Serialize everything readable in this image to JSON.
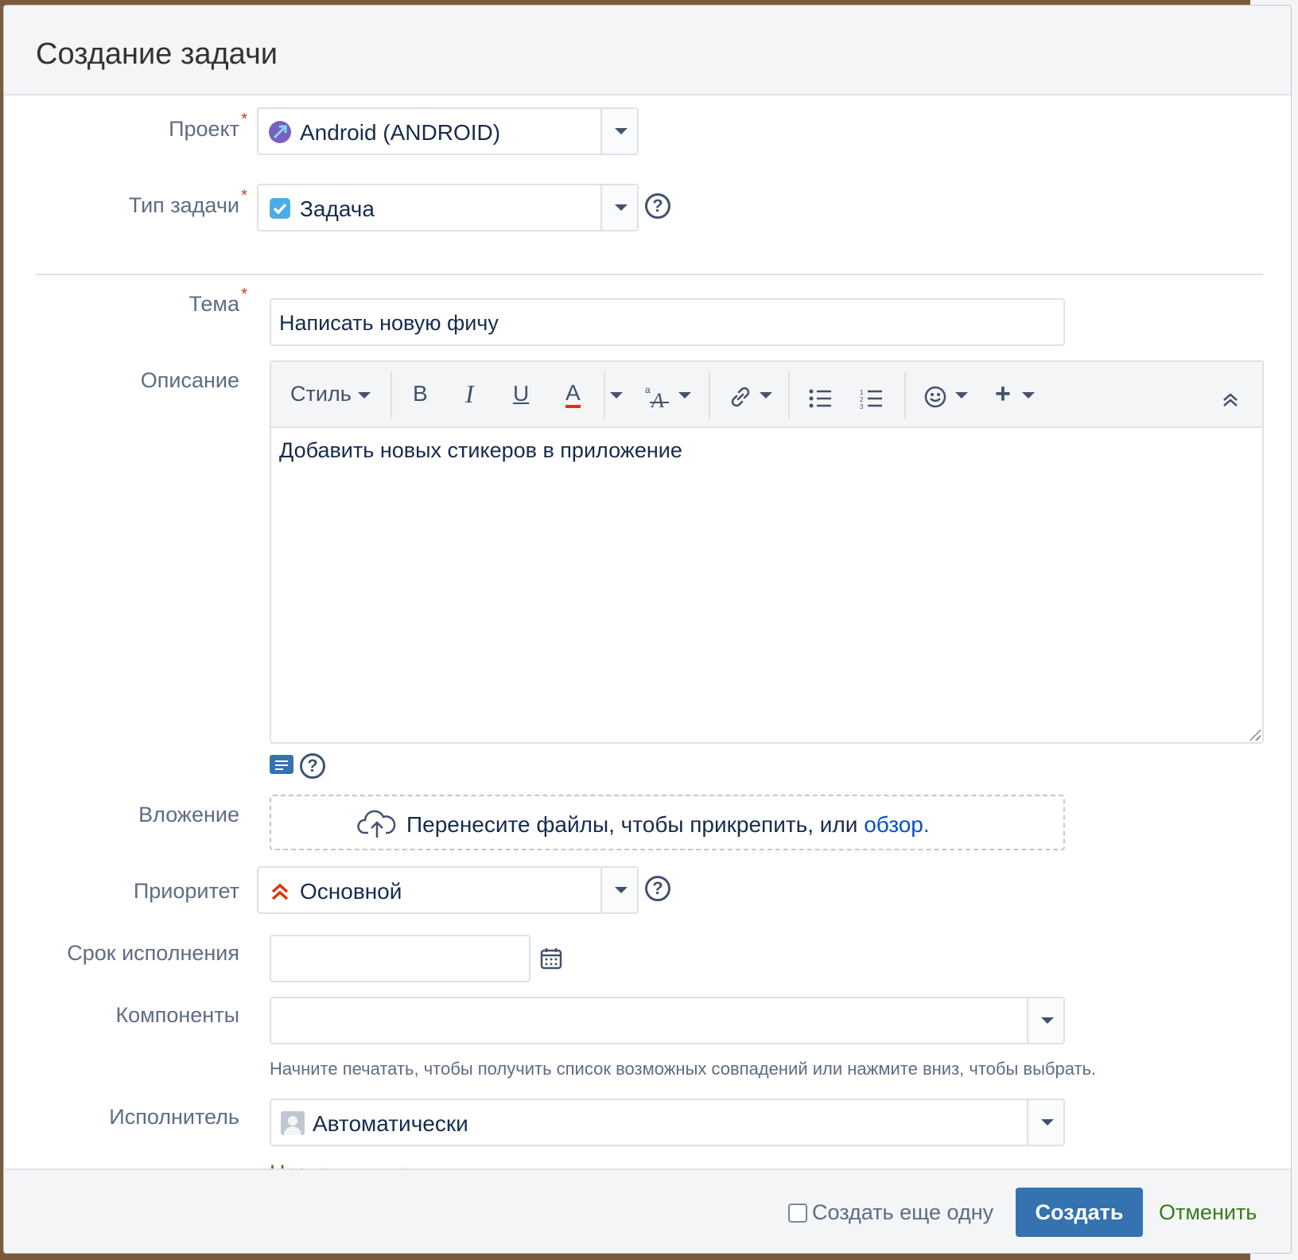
{
  "dialog": {
    "title": "Создание задачи"
  },
  "fields": {
    "project": {
      "label": "Проект",
      "value": "Android (ANDROID)",
      "required": true
    },
    "issue_type": {
      "label": "Тип задачи",
      "value": "Задача",
      "required": true
    },
    "summary": {
      "label": "Тема",
      "value": "Написать новую фичу",
      "required": true
    },
    "description": {
      "label": "Описание",
      "toolbar": {
        "style": "Стиль",
        "bold": "B",
        "italic": "I",
        "underline": "U",
        "color": "A"
      },
      "content": "Добавить новых стикеров в приложение"
    },
    "attachment": {
      "label": "Вложение",
      "text": "Перенесите файлы, чтобы прикрепить, или",
      "browse": "обзор."
    },
    "priority": {
      "label": "Приоритет",
      "value": "Основной"
    },
    "due_date": {
      "label": "Срок исполнения",
      "value": ""
    },
    "components": {
      "label": "Компоненты",
      "value": "",
      "hint": "Начните печатать, чтобы получить список возможных совпадений или нажмите вниз, чтобы выбрать."
    },
    "assignee": {
      "label": "Исполнитель",
      "value": "Автоматически",
      "assign_me": "Назначить меня"
    }
  },
  "footer": {
    "create_another": "Создать еще одну",
    "create_another_checked": false,
    "create": "Создать",
    "cancel": "Отменить"
  },
  "colors": {
    "primary": "#3572b0",
    "cancel": "#3b7b1c",
    "required": "#de350b",
    "link": "#0052cc"
  },
  "icons": [
    "project-avatar-icon",
    "task-type-icon",
    "help-icon",
    "bold-icon",
    "italic-icon",
    "underline-icon",
    "text-color-icon",
    "text-effects-icon",
    "link-icon",
    "bullet-list-icon",
    "numbered-list-icon",
    "emoji-icon",
    "insert-icon",
    "collapse-icon",
    "text-mode-icon",
    "upload-cloud-icon",
    "priority-major-icon",
    "calendar-icon",
    "user-avatar-icon"
  ]
}
